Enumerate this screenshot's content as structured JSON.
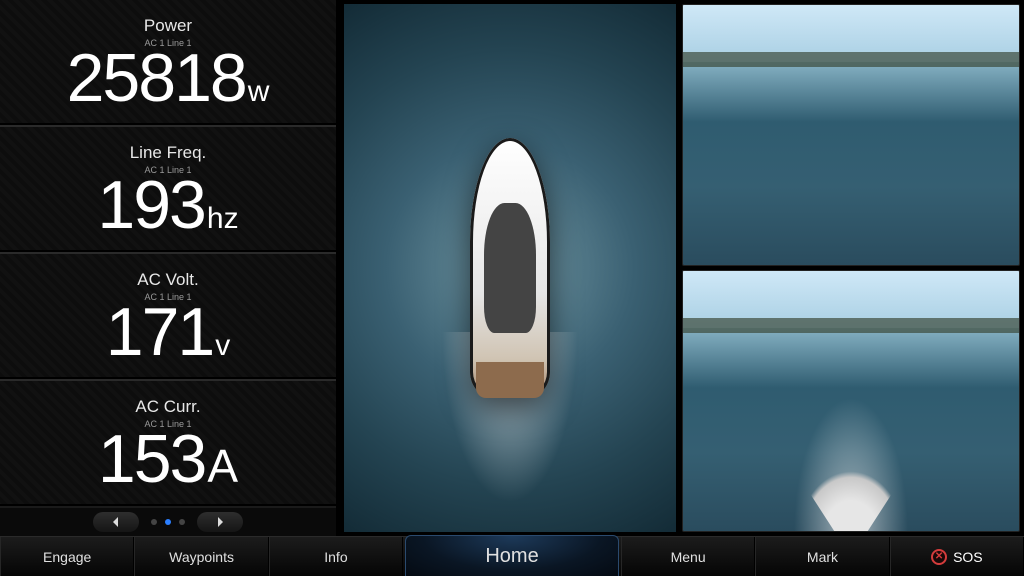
{
  "gauges": [
    {
      "title": "Power",
      "sub": "AC 1 Line 1",
      "value": "25818",
      "unit": "w",
      "unit_big": false
    },
    {
      "title": "Line Freq.",
      "sub": "AC 1 Line 1",
      "value": "193",
      "unit": "hz",
      "unit_big": false
    },
    {
      "title": "AC Volt.",
      "sub": "AC 1 Line 1",
      "value": "171",
      "unit": "v",
      "unit_big": false
    },
    {
      "title": "AC Curr.",
      "sub": "AC 1 Line 1",
      "value": "153",
      "unit": "A",
      "unit_big": true
    }
  ],
  "pager": {
    "active_index": 1,
    "count": 3
  },
  "cameras": {
    "center": "birdseye-camera",
    "top_right": "bow-camera",
    "bottom_right": "stern-camera"
  },
  "nav": {
    "engage": "Engage",
    "waypoints": "Waypoints",
    "info": "Info",
    "home": "Home",
    "menu": "Menu",
    "mark": "Mark",
    "sos": "SOS"
  }
}
